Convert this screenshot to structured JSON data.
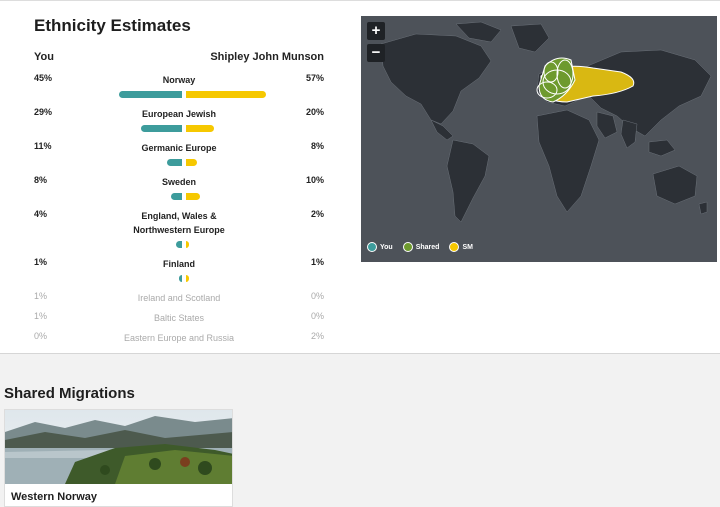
{
  "ethnicity": {
    "title": "Ethnicity Estimates",
    "you_label": "You",
    "match_label": "Shipley John Munson",
    "rows": [
      {
        "name": "Norway",
        "you": "45%",
        "match": "57%",
        "you_frac": 0.45,
        "match_frac": 0.57
      },
      {
        "name": "European Jewish",
        "you": "29%",
        "match": "20%",
        "you_frac": 0.29,
        "match_frac": 0.2
      },
      {
        "name": "Germanic Europe",
        "you": "11%",
        "match": "8%",
        "you_frac": 0.11,
        "match_frac": 0.08
      },
      {
        "name": "Sweden",
        "you": "8%",
        "match": "10%",
        "you_frac": 0.08,
        "match_frac": 0.1
      },
      {
        "name": "England, Wales & Northwestern Europe",
        "you": "4%",
        "match": "2%",
        "you_frac": 0.04,
        "match_frac": 0.02
      },
      {
        "name": "Finland",
        "you": "1%",
        "match": "1%",
        "you_frac": 0.01,
        "match_frac": 0.01
      }
    ],
    "muted_rows": [
      {
        "name": "Ireland and Scotland",
        "you": "1%",
        "match": "0%"
      },
      {
        "name": "Baltic States",
        "you": "1%",
        "match": "0%"
      },
      {
        "name": "Eastern Europe and Russia",
        "you": "0%",
        "match": "2%"
      }
    ]
  },
  "map": {
    "zoom_in": "+",
    "zoom_out": "−",
    "legend": [
      {
        "label": "You",
        "color": "#3d9c9c"
      },
      {
        "label": "Shared",
        "color": "#6e9a2e"
      },
      {
        "label": "SM",
        "color": "#f6c800"
      }
    ]
  },
  "migrations": {
    "title": "Shared Migrations",
    "cards": [
      {
        "name": "Western Norway"
      }
    ]
  },
  "colors": {
    "you": "#3d9c9c",
    "match": "#f6c800",
    "shared": "#6e9a2e",
    "map_bg": "#4d5259"
  }
}
